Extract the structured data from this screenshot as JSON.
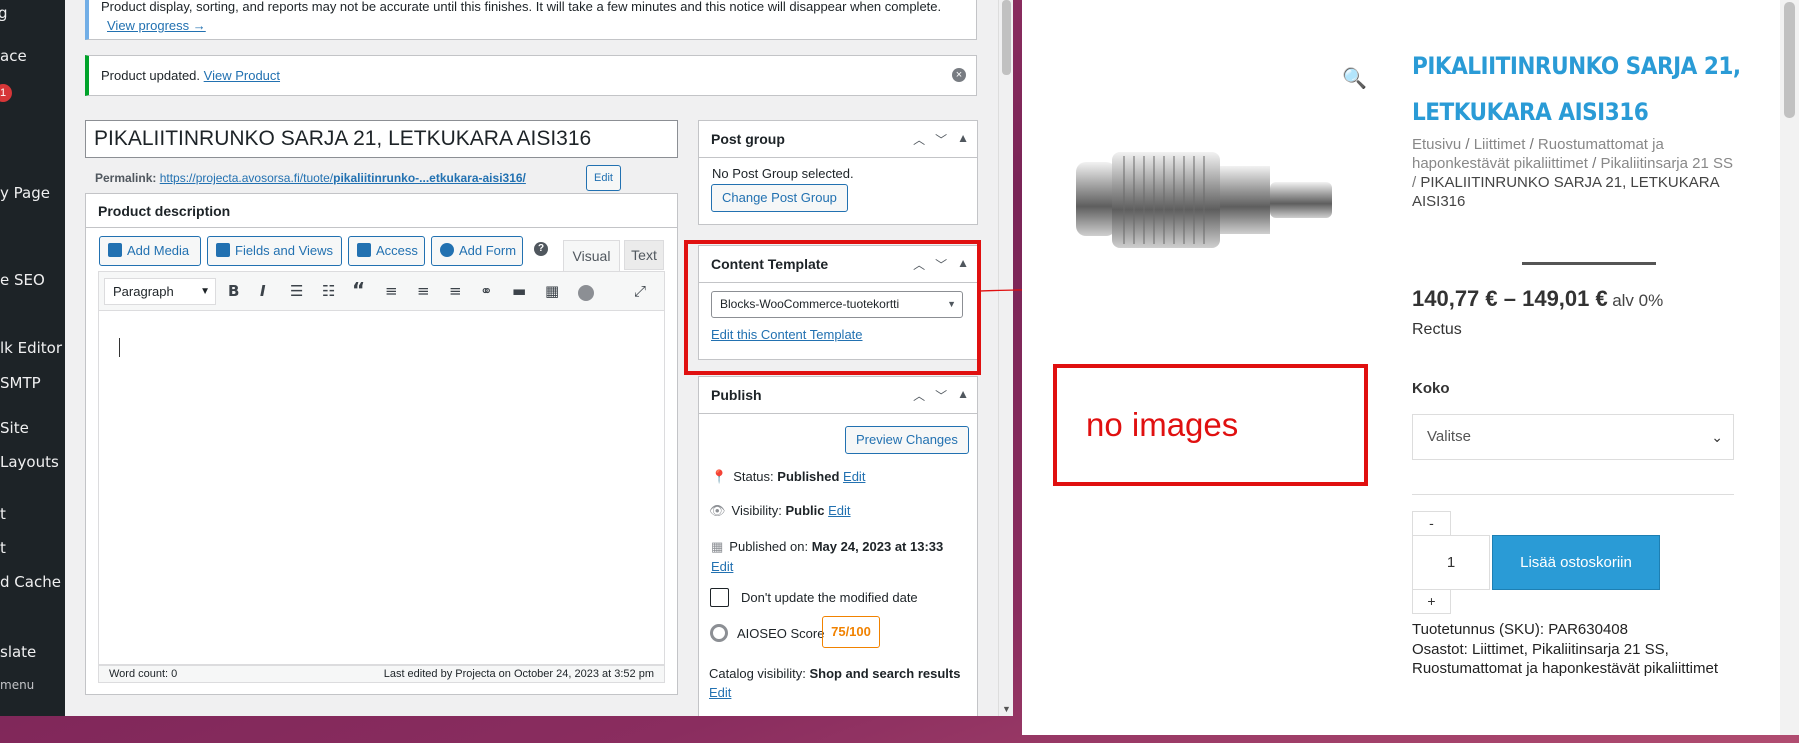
{
  "admin_menu": {
    "items": [
      "g",
      "ace",
      "y Page",
      "e SEO",
      "lk Editor",
      "SMTP",
      "Site",
      "Layouts",
      "t",
      "t",
      "d Cache",
      "slate"
    ],
    "badge": "1",
    "collapse_label": "menu"
  },
  "notices": {
    "progress_text": "Product display, sorting, and reports may not be accurate until this finishes. It will take a few minutes and this notice will disappear when complete.",
    "progress_link": "View progress →",
    "updated_text": "Product updated.",
    "updated_link": "View Product"
  },
  "post": {
    "title": "PIKALIITINRUNKO SARJA 21, LETKUKARA AISI316",
    "permalink_label": "Permalink:",
    "permalink_base": "https://projecta.avosorsa.fi/tuote/",
    "permalink_slug": "pikaliitinrunko-...etkukara-aisi316/",
    "permalink_edit": "Edit"
  },
  "editor": {
    "title": "Product description",
    "buttons": {
      "add_media": "Add Media",
      "fields_views": "Fields and Views",
      "access": "Access",
      "add_form": "Add Form"
    },
    "tabs": {
      "visual": "Visual",
      "text": "Text"
    },
    "format_select": "Paragraph",
    "word_count": "Word count: 0",
    "last_edited": "Last edited by Projecta on October 24, 2023 at 3:52 pm"
  },
  "post_group": {
    "title": "Post group",
    "none_text": "No Post Group selected.",
    "change_button": "Change Post Group"
  },
  "content_template": {
    "title": "Content Template",
    "selected": "Blocks-WooCommerce-tuotekortti",
    "edit_link": "Edit this Content Template"
  },
  "publish": {
    "title": "Publish",
    "preview_button": "Preview Changes",
    "status_label": "Status:",
    "status_value": "Published",
    "visibility_label": "Visibility:",
    "visibility_value": "Public",
    "published_label": "Published on:",
    "published_value": "May 24, 2023 at 13:33",
    "edit": "Edit",
    "dont_update": "Don't update the modified date",
    "aioseo_label": "AIOSEO Score",
    "aioseo_score": "75/100",
    "catalog_label": "Catalog visibility:",
    "catalog_value": "Shop and search results"
  },
  "annotation": {
    "text": "no images",
    "color": "#e01010"
  },
  "product": {
    "title_line1": "PIKALIITINRUNKO SARJA 21,",
    "title_line2": "LETKUKARA AISI316",
    "breadcrumb": {
      "home": "Etusivu",
      "c1": "Liittimet",
      "c2": "Ruostumattomat ja haponkestävät pikaliittimet",
      "c3": "Pikaliitinsarja 21 SS",
      "current": "PIKALIITINRUNKO SARJA 21, LETKUKARA AISI316",
      "sep": "/"
    },
    "price": "140,77 € – 149,01 €",
    "price_suffix": "alv 0%",
    "brand": "Rectus",
    "size_label": "Koko",
    "size_select": "Valitse",
    "qty_minus": "-",
    "qty_value": "1",
    "qty_plus": "+",
    "add_to_cart": "Lisää ostoskoriin",
    "sku_label": "Tuotetunnus (SKU):",
    "sku_value": "PAR630408",
    "categories_label": "Osastot:",
    "categories_value": "Liittimet, Pikaliitinsarja 21 SS, Ruostumattomat ja haponkestävät pikaliittimet",
    "accent_color": "#2a9bd6"
  }
}
